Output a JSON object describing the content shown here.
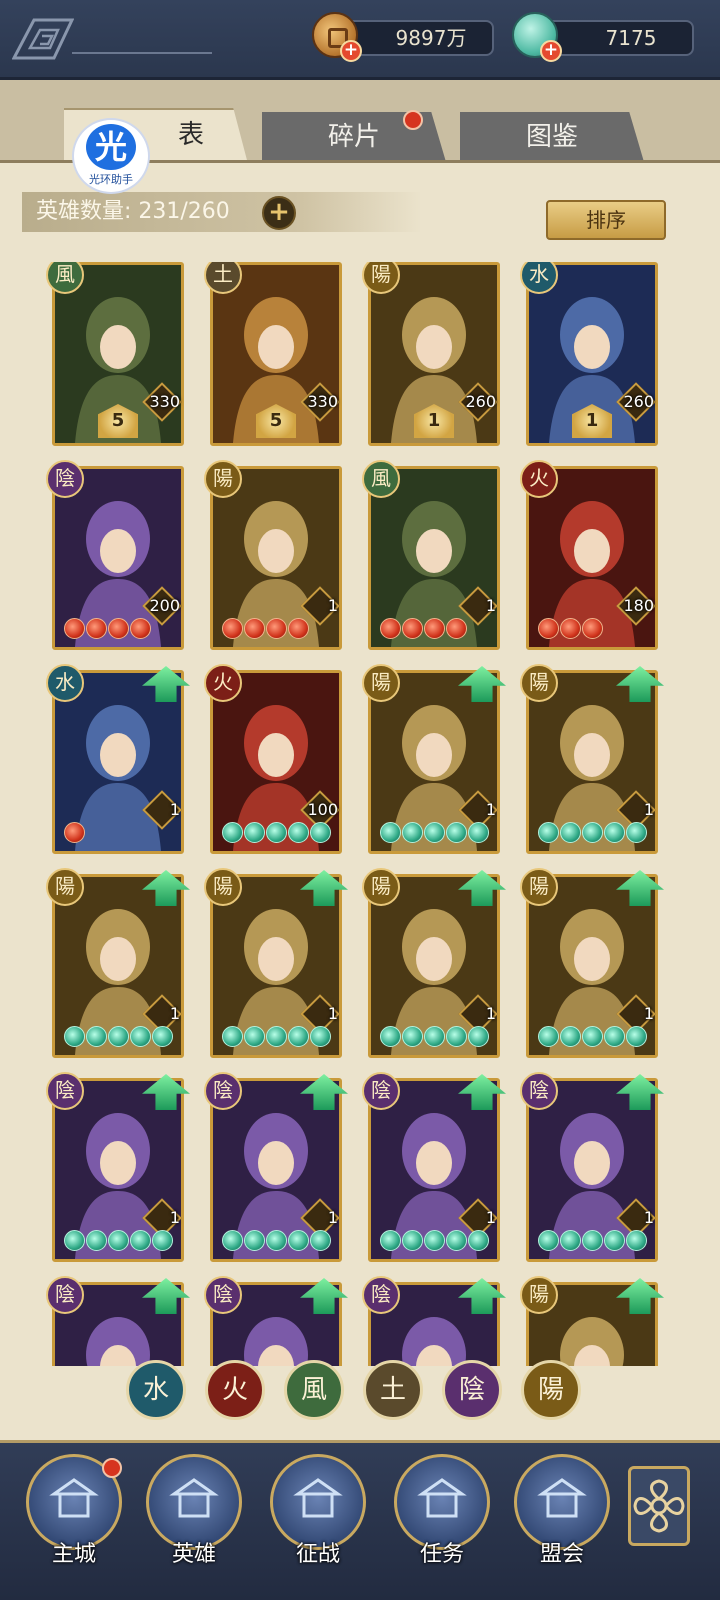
{
  "topbar": {
    "coins": "9897万",
    "jade": "7175"
  },
  "tabs": [
    {
      "label": "表",
      "active": true
    },
    {
      "label": "碎片",
      "active": false,
      "badge": true
    },
    {
      "label": "图鉴",
      "active": false
    }
  ],
  "helper_logo": {
    "glyph": "光",
    "text": "光环助手"
  },
  "hero_count": "英雄数量: 231/260",
  "sort_label": "排序",
  "heroes": [
    {
      "element": "風",
      "el": "wind",
      "level": "330",
      "stars": "5",
      "upgrade": false
    },
    {
      "element": "土",
      "el": "earth",
      "level": "330",
      "stars": "5",
      "upgrade": false
    },
    {
      "element": "陽",
      "el": "yang",
      "level": "260",
      "stars": "1",
      "upgrade": false
    },
    {
      "element": "水",
      "el": "water",
      "level": "260",
      "stars": "1",
      "upgrade": false
    },
    {
      "element": "陰",
      "el": "yin",
      "level": "200",
      "orbs": "red",
      "orbCount": 4,
      "upgrade": false
    },
    {
      "element": "陽",
      "el": "yang",
      "level": "1",
      "orbs": "red",
      "orbCount": 4,
      "upgrade": false
    },
    {
      "element": "風",
      "el": "wind",
      "level": "1",
      "orbs": "red",
      "orbCount": 4,
      "upgrade": false
    },
    {
      "element": "火",
      "el": "fire",
      "level": "180",
      "orbs": "red",
      "orbCount": 3,
      "upgrade": false
    },
    {
      "element": "水",
      "el": "water",
      "level": "1",
      "orbs": "red",
      "orbCount": 1,
      "upgrade": true
    },
    {
      "element": "火",
      "el": "fire",
      "level": "100",
      "orbs": "green",
      "orbCount": 5,
      "upgrade": false
    },
    {
      "element": "陽",
      "el": "yang",
      "level": "1",
      "orbs": "green",
      "orbCount": 5,
      "upgrade": true
    },
    {
      "element": "陽",
      "el": "yang",
      "level": "1",
      "orbs": "green",
      "orbCount": 5,
      "upgrade": true
    },
    {
      "element": "陽",
      "el": "yang",
      "level": "1",
      "orbs": "green",
      "orbCount": 5,
      "upgrade": true
    },
    {
      "element": "陽",
      "el": "yang",
      "level": "1",
      "orbs": "green",
      "orbCount": 5,
      "upgrade": true
    },
    {
      "element": "陽",
      "el": "yang",
      "level": "1",
      "orbs": "green",
      "orbCount": 5,
      "upgrade": true
    },
    {
      "element": "陽",
      "el": "yang",
      "level": "1",
      "orbs": "green",
      "orbCount": 5,
      "upgrade": true
    },
    {
      "element": "陰",
      "el": "yin",
      "level": "1",
      "orbs": "green",
      "orbCount": 5,
      "upgrade": true
    },
    {
      "element": "陰",
      "el": "yin",
      "level": "1",
      "orbs": "green",
      "orbCount": 5,
      "upgrade": true
    },
    {
      "element": "陰",
      "el": "yin",
      "level": "1",
      "orbs": "green",
      "orbCount": 5,
      "upgrade": true
    },
    {
      "element": "陰",
      "el": "yin",
      "level": "1",
      "orbs": "green",
      "orbCount": 5,
      "upgrade": true
    },
    {
      "element": "陰",
      "el": "yin",
      "upgrade": true
    },
    {
      "element": "陰",
      "el": "yin",
      "upgrade": true
    },
    {
      "element": "陰",
      "el": "yin",
      "upgrade": true
    },
    {
      "element": "陽",
      "el": "yang",
      "upgrade": true
    }
  ],
  "filters": [
    {
      "glyph": "水",
      "el": "water"
    },
    {
      "glyph": "火",
      "el": "fire"
    },
    {
      "glyph": "風",
      "el": "wind"
    },
    {
      "glyph": "土",
      "el": "earth"
    },
    {
      "glyph": "陰",
      "el": "yin"
    },
    {
      "glyph": "陽",
      "el": "yang"
    }
  ],
  "nav": [
    {
      "label": "主城",
      "icon": "city-gate-icon",
      "badge": true
    },
    {
      "label": "英雄",
      "icon": "hero-portrait-icon",
      "badge": false
    },
    {
      "label": "征战",
      "icon": "campaign-scroll-icon",
      "badge": false
    },
    {
      "label": "任务",
      "icon": "task-flag-icon",
      "badge": false
    },
    {
      "label": "盟会",
      "icon": "alliance-pavilion-icon",
      "badge": false
    }
  ],
  "colors": {
    "panel": "#ebe3cc",
    "card_border": "#c99a3a",
    "accent_red": "#d6341f",
    "accent_green": "#2fa986"
  }
}
